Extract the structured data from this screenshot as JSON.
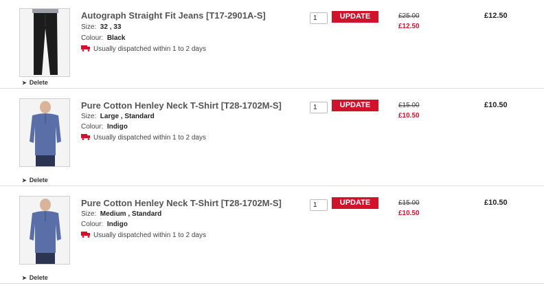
{
  "items": [
    {
      "title": "Autograph Straight Fit Jeans [T17-2901A-S]",
      "size_label": "Size:",
      "size_value": "32 , 33",
      "colour_label": "Colour:",
      "colour_value": "Black",
      "dispatch": "Usually dispatched within 1 to 2 days",
      "quantity": "1",
      "update_label": "UPDATE",
      "was_price": "£25.00",
      "now_price": "£12.50",
      "line_total": "£12.50",
      "delete_label": "Delete",
      "image_icon": "jeans-product-image"
    },
    {
      "title": "Pure Cotton Henley Neck T-Shirt [T28-1702M-S]",
      "size_label": "Size:",
      "size_value": "Large , Standard",
      "colour_label": "Colour:",
      "colour_value": "Indigo",
      "dispatch": "Usually dispatched within 1 to 2 days",
      "quantity": "1",
      "update_label": "UPDATE",
      "was_price": "£15.00",
      "now_price": "£10.50",
      "line_total": "£10.50",
      "delete_label": "Delete",
      "image_icon": "henley-shirt-product-image"
    },
    {
      "title": "Pure Cotton Henley Neck T-Shirt [T28-1702M-S]",
      "size_label": "Size:",
      "size_value": "Medium , Standard",
      "colour_label": "Colour:",
      "colour_value": "Indigo",
      "dispatch": "Usually dispatched within 1 to 2 days",
      "quantity": "1",
      "update_label": "UPDATE",
      "was_price": "£15.00",
      "now_price": "£10.50",
      "line_total": "£10.50",
      "delete_label": "Delete",
      "image_icon": "henley-shirt-product-image"
    }
  ],
  "colors": {
    "accent_red": "#d0132b",
    "divider": "#dcdcdc",
    "indigo_shirt": "#5a6fa8",
    "black_jeans": "#1c1c1c"
  }
}
